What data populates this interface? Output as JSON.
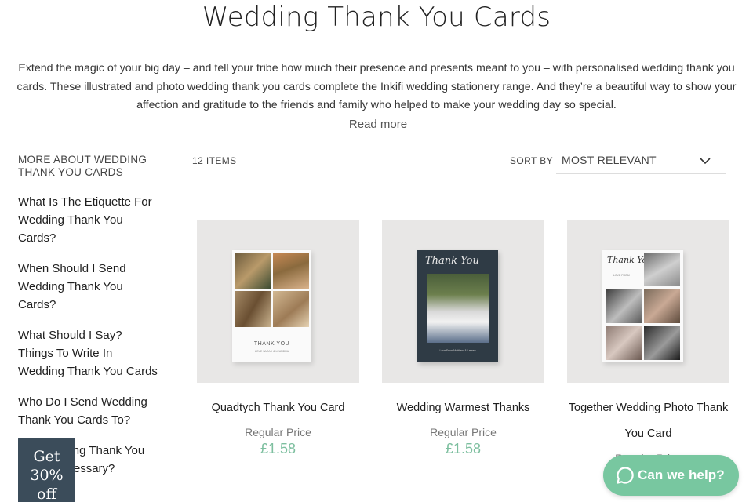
{
  "page": {
    "title": "Wedding Thank You Cards",
    "intro": "Extend the magic of your big day – and tell your tribe how much their presence and presents meant to you – with personalised wedding thank you cards. These illustrated and photo wedding thank you cards complete the Inkifi wedding stationery range. And they’re a beautiful way to show your affection and gratitude to the friends and family who helped to make your wedding day so special.",
    "read_more": "Read more"
  },
  "sidebar": {
    "heading": "MORE ABOUT WEDDING THANK YOU CARDS",
    "links": [
      "What Is The Etiquette For Wedding Thank You Cards?",
      "When Should I Send Wedding Thank You Cards?",
      "What Should I Say? Things To Write In Wedding Thank You Cards",
      "Who Do I Send Wedding Thank You Cards To?",
      "Are Wedding Thank You Cards Necessary?"
    ]
  },
  "toolbar": {
    "item_count": "12 ITEMS",
    "sort_label": "SORT BY",
    "sort_value": "MOST RELEVANT"
  },
  "products": [
    {
      "name": "Quadtych Thank You Card",
      "price_label": "Regular Price",
      "price": "£1.58",
      "card_text": "THANK YOU",
      "card_subtext": "LOVE SARAH & LEANDRA"
    },
    {
      "name": "Wedding Warmest Thanks",
      "price_label": "Regular Price",
      "price": "£1.58",
      "card_text": "Thank You",
      "card_subtext": "Love From Matthew & Lauren"
    },
    {
      "name": "Together Wedding Photo Thank You Card",
      "price_label": "Regular Price",
      "price": "",
      "card_text": "Thank You",
      "card_subtext": "LOVE FROM"
    }
  ],
  "promo": {
    "line1": "Get",
    "line2": "30%",
    "line3": "off"
  },
  "chat": {
    "label": "Can we help?"
  },
  "colors": {
    "price_green": "#7dbf9f",
    "chat_green": "#78c7a0",
    "promo_bg": "#3b4c5a",
    "card_navy": "#2f3b45"
  },
  "icons": [
    "chevron-down-icon",
    "chat-bubble-icon"
  ]
}
